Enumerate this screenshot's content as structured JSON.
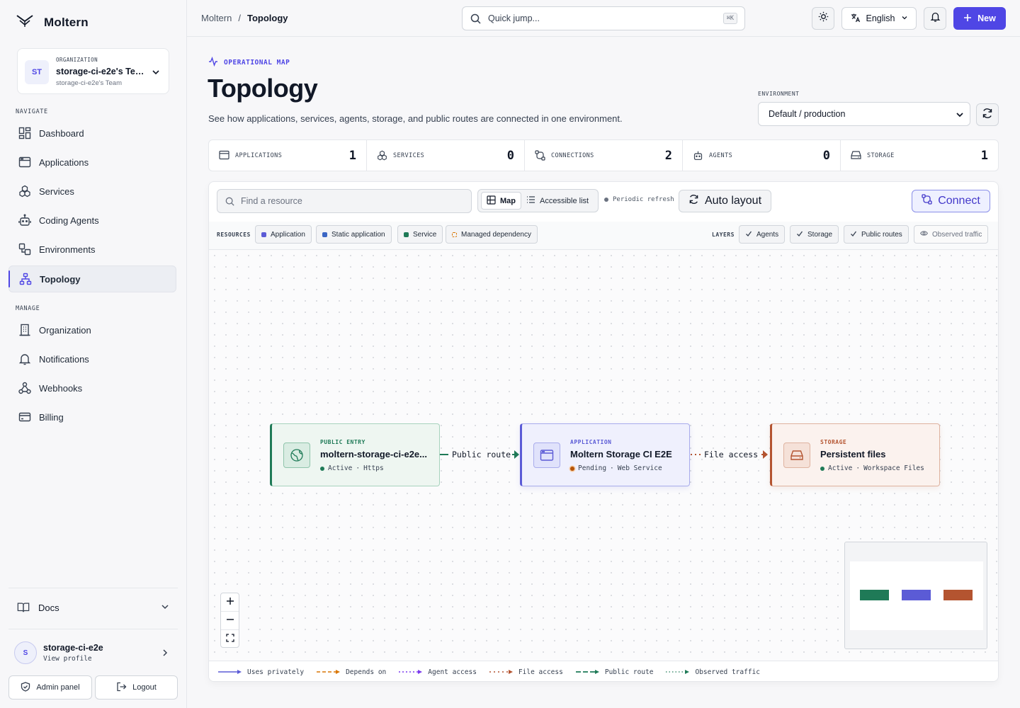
{
  "app": {
    "name": "Moltern"
  },
  "org": {
    "eyebrow": "ORGANIZATION",
    "avatar": "ST",
    "name": "storage-ci-e2e's Team",
    "sub": "storage-ci-e2e's Team"
  },
  "nav": {
    "navigate_heading": "NAVIGATE",
    "manage_heading": "MANAGE",
    "items": [
      {
        "label": "Dashboard",
        "icon": "dashboard-icon"
      },
      {
        "label": "Applications",
        "icon": "window-icon"
      },
      {
        "label": "Services",
        "icon": "cubes-icon"
      },
      {
        "label": "Coding Agents",
        "icon": "robot-icon"
      },
      {
        "label": "Environments",
        "icon": "environments-icon"
      },
      {
        "label": "Topology",
        "icon": "topology-icon",
        "active": true
      },
      {
        "label": "Organization",
        "icon": "building-icon"
      },
      {
        "label": "Notifications",
        "icon": "bell-icon"
      },
      {
        "label": "Webhooks",
        "icon": "webhook-icon"
      },
      {
        "label": "Billing",
        "icon": "credit-card-icon"
      }
    ]
  },
  "docs": {
    "label": "Docs"
  },
  "profile": {
    "avatar": "S",
    "name": "storage-ci-e2e",
    "sub": "View profile"
  },
  "admin": {
    "label": "Admin panel"
  },
  "logout": {
    "label": "Logout"
  },
  "breadcrumb": {
    "root": "Moltern",
    "sep": "/",
    "current": "Topology"
  },
  "quickjump": {
    "placeholder": "Quick jump...",
    "shortcut": "⌘K"
  },
  "language": {
    "label": "English"
  },
  "new_button": {
    "label": "New"
  },
  "header": {
    "eyebrow": "OPERATIONAL MAP",
    "title": "Topology",
    "description": "See how applications, services, agents, storage, and public routes are connected in one environment."
  },
  "environment": {
    "label": "ENVIRONMENT",
    "value": "Default / production"
  },
  "stats": [
    {
      "label": "APPLICATIONS",
      "value": "1",
      "icon": "window-icon"
    },
    {
      "label": "SERVICES",
      "value": "0",
      "icon": "cubes-icon"
    },
    {
      "label": "CONNECTIONS",
      "value": "2",
      "icon": "connections-icon"
    },
    {
      "label": "AGENTS",
      "value": "0",
      "icon": "robot-icon"
    },
    {
      "label": "STORAGE",
      "value": "1",
      "icon": "hard-drive-icon"
    }
  ],
  "toolbar": {
    "find_placeholder": "Find a resource",
    "view_map": "Map",
    "view_list": "Accessible list",
    "periodic": "Periodic refresh",
    "auto_layout": "Auto layout",
    "connect": "Connect"
  },
  "filters": {
    "resources_label": "RESOURCES",
    "resources": [
      {
        "label": "Application",
        "color": "#5b5bd6"
      },
      {
        "label": "Static application",
        "color": "#3b66c4"
      },
      {
        "label": "Service",
        "color": "#1f7a57"
      },
      {
        "label": "Managed dependency",
        "color": "#d97706"
      }
    ],
    "layers_label": "LAYERS",
    "layers": [
      {
        "label": "Agents",
        "on": true
      },
      {
        "label": "Storage",
        "on": true
      },
      {
        "label": "Public routes",
        "on": true
      },
      {
        "label": "Observed traffic",
        "on": false
      }
    ]
  },
  "nodes": [
    {
      "eyebrow": "PUBLIC ENTRY",
      "title": "moltern-storage-ci-e2e...",
      "status": "Active",
      "detail": "Https",
      "status_color": "#1f7a57",
      "accent": "#1f7a57",
      "icon": "globe-icon"
    },
    {
      "eyebrow": "APPLICATION",
      "title": "Moltern Storage CI E2E",
      "status": "Pending",
      "detail": "Web Service",
      "status_color": "#b45309",
      "accent": "#5b5bd6",
      "icon": "window-icon"
    },
    {
      "eyebrow": "STORAGE",
      "title": "Persistent files",
      "status": "Active",
      "detail": "Workspace Files",
      "status_color": "#1f7a57",
      "accent": "#b45430",
      "icon": "hard-drive-icon"
    }
  ],
  "edges": [
    {
      "label": "Public route"
    },
    {
      "label": "File access"
    }
  ],
  "legend": [
    {
      "label": "Uses privately",
      "color": "#5b5bd6",
      "style": "solid"
    },
    {
      "label": "Depends on",
      "color": "#d97706",
      "style": "dashed"
    },
    {
      "label": "Agent access",
      "color": "#7c3aed",
      "style": "dotted"
    },
    {
      "label": "File access",
      "color": "#b45430",
      "style": "dotted"
    },
    {
      "label": "Public route",
      "color": "#1f7a57",
      "style": "dashed"
    },
    {
      "label": "Observed traffic",
      "color": "#1f7a57",
      "style": "dotted"
    }
  ],
  "colors": {
    "accent": "#4f46e5",
    "public": "#1f7a57",
    "app": "#5b5bd6",
    "storage": "#b45430"
  }
}
